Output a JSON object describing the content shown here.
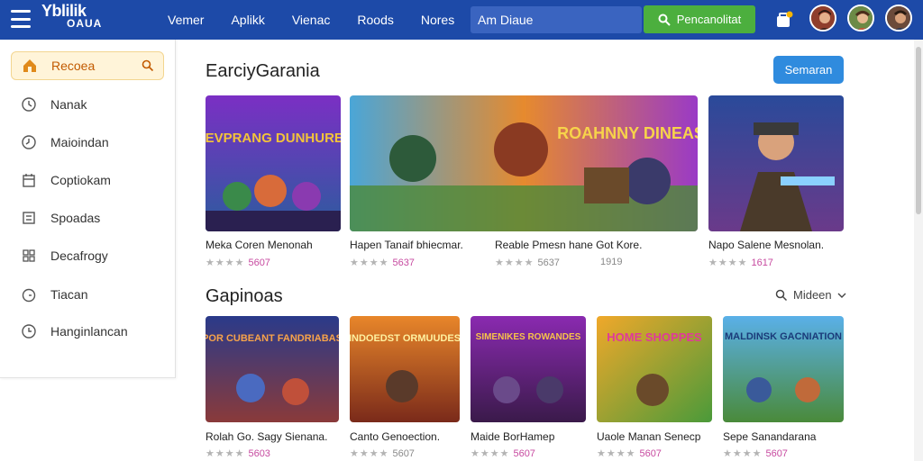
{
  "header": {
    "logo_line1": "Yblilik",
    "logo_line2": "OAUA",
    "nav": [
      "Vemer",
      "Aplikk",
      "Vienac",
      "Roods",
      "Nores"
    ],
    "search_placeholder": "Am Diaue",
    "search_button": "Pencanolitat",
    "brand_color": "#1d4aa8",
    "accent_green": "#4caf3e"
  },
  "sidebar": {
    "items": [
      {
        "label": "Recoea",
        "icon": "house-icon"
      },
      {
        "label": "Nanak",
        "icon": "history-icon"
      },
      {
        "label": "Maioindan",
        "icon": "clock-icon"
      },
      {
        "label": "Coptiokam",
        "icon": "calendar-icon"
      },
      {
        "label": "Spoadas",
        "icon": "list-icon"
      },
      {
        "label": "Decafrogy",
        "icon": "grid-icon"
      },
      {
        "label": "Tiacan",
        "icon": "timer-icon"
      },
      {
        "label": "Hanginlancan",
        "icon": "clock-icon"
      }
    ]
  },
  "section1": {
    "title": "EarciyGarania",
    "button": "Semaran",
    "cards": [
      {
        "title": "Meka Coren Menonah",
        "stars": "★★★★",
        "rating": "5607"
      },
      {
        "title": "Hapen Tanaif bhiecmar.",
        "stars": "★★★★",
        "rating": "5637"
      },
      {
        "title": "Reable Pmesn hane Got Kore.",
        "stars": "★★★★",
        "rating": "5637",
        "extra": "1919"
      },
      {
        "title": "Napo Salene Mesnolan.",
        "stars": "★★★★",
        "rating": "1617"
      }
    ]
  },
  "section2": {
    "title": "Gapinoas",
    "sort_label": "Mideen",
    "cards": [
      {
        "title": "Rolah Go. Sagy Sienana.",
        "stars": "★★★★",
        "rating": "5603"
      },
      {
        "title": "Canto Genoection.",
        "stars": "★★★★",
        "rating": "5607"
      },
      {
        "title": "Maide BorHamep",
        "stars": "★★★★",
        "rating": "5607"
      },
      {
        "title": "Uaole Manan Senecp",
        "stars": "★★★★",
        "rating": "5607"
      },
      {
        "title": "Sepe Sanandarana",
        "stars": "★★★★",
        "rating": "5607"
      }
    ]
  },
  "thumb_text": {
    "s1_c1": "MEVPRANG DUNHURES",
    "s1_c2": "ROAHNNY DINEASS",
    "s2_c1": "POR CUBEANT FANDRIABAS",
    "s2_c2": "INDOEDST ORMUUDES",
    "s2_c3": "SIMENIKES ROWANDES",
    "s2_c4": "HOME SHOPPES",
    "s2_c5": "MALDINSK GACNIATION"
  }
}
